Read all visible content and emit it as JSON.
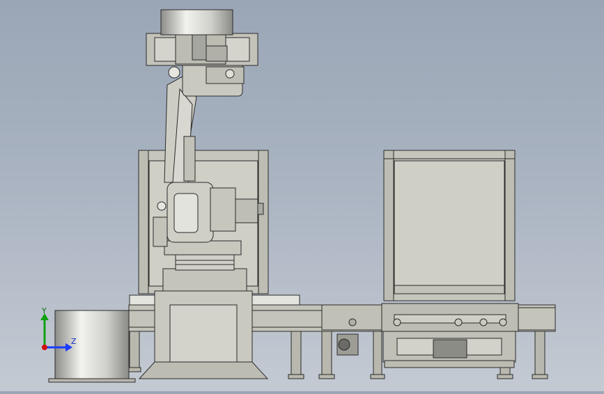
{
  "viewport": {
    "background_top": "#9aa6b6",
    "background_bottom": "#c4cad3",
    "model_line_color": "#2a2a2a",
    "model_fill": "#c9c9c0"
  },
  "triad": {
    "y_label": "Y",
    "z_label": "Z",
    "y_color": "#10a010",
    "z_color": "#1a3cff",
    "origin_color": "#d01010"
  }
}
